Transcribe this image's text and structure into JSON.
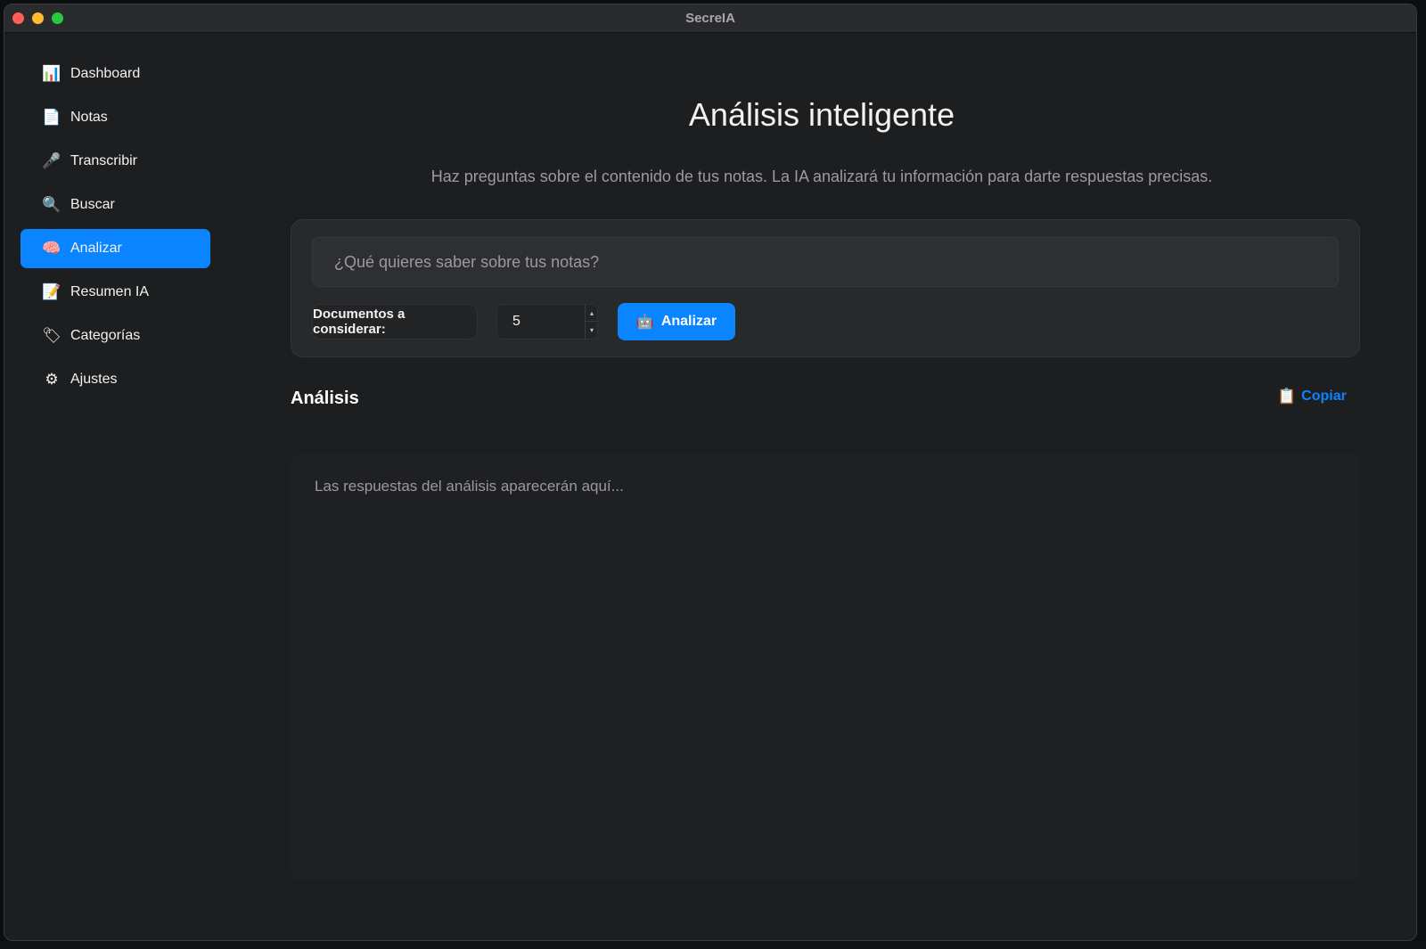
{
  "window": {
    "title": "SecreIA"
  },
  "sidebar": {
    "items": [
      {
        "label": "Dashboard",
        "icon": "bar-chart-icon",
        "glyph": "📊",
        "active": false
      },
      {
        "label": "Notas",
        "icon": "document-icon",
        "glyph": "📄",
        "active": false
      },
      {
        "label": "Transcribir",
        "icon": "microphone-icon",
        "glyph": "🎤",
        "active": false
      },
      {
        "label": "Buscar",
        "icon": "search-icon",
        "glyph": "🔍",
        "active": false
      },
      {
        "label": "Analizar",
        "icon": "brain-icon",
        "glyph": "🧠",
        "active": true
      },
      {
        "label": "Resumen IA",
        "icon": "memo-icon",
        "glyph": "📝",
        "active": false
      },
      {
        "label": "Categorías",
        "icon": "tag-icon",
        "glyph": "🏷",
        "active": false
      },
      {
        "label": "Ajustes",
        "icon": "gear-icon",
        "glyph": "⚙",
        "active": false
      }
    ]
  },
  "main": {
    "title": "Análisis inteligente",
    "subtitle": "Haz preguntas sobre el contenido de tus notas. La IA analizará tu información para darte respuestas precisas.",
    "query": {
      "placeholder": "¿Qué quieres saber sobre tus notas?",
      "value": "",
      "docs_label": "Documentos a considerar:",
      "docs_value": "5",
      "analyze_label": "Analizar",
      "analyze_icon": "robot-icon",
      "analyze_glyph": "🤖"
    },
    "result": {
      "title": "Análisis",
      "copy_label": "Copiar",
      "copy_icon": "clipboard-icon",
      "copy_glyph": "📋",
      "placeholder": "Las respuestas del análisis aparecerán aquí..."
    }
  },
  "colors": {
    "accent": "#0a84ff",
    "background": "#1d1e20",
    "card": "#28292b",
    "text": "#f2f2f2",
    "muted_text": "#9c9ca0"
  }
}
